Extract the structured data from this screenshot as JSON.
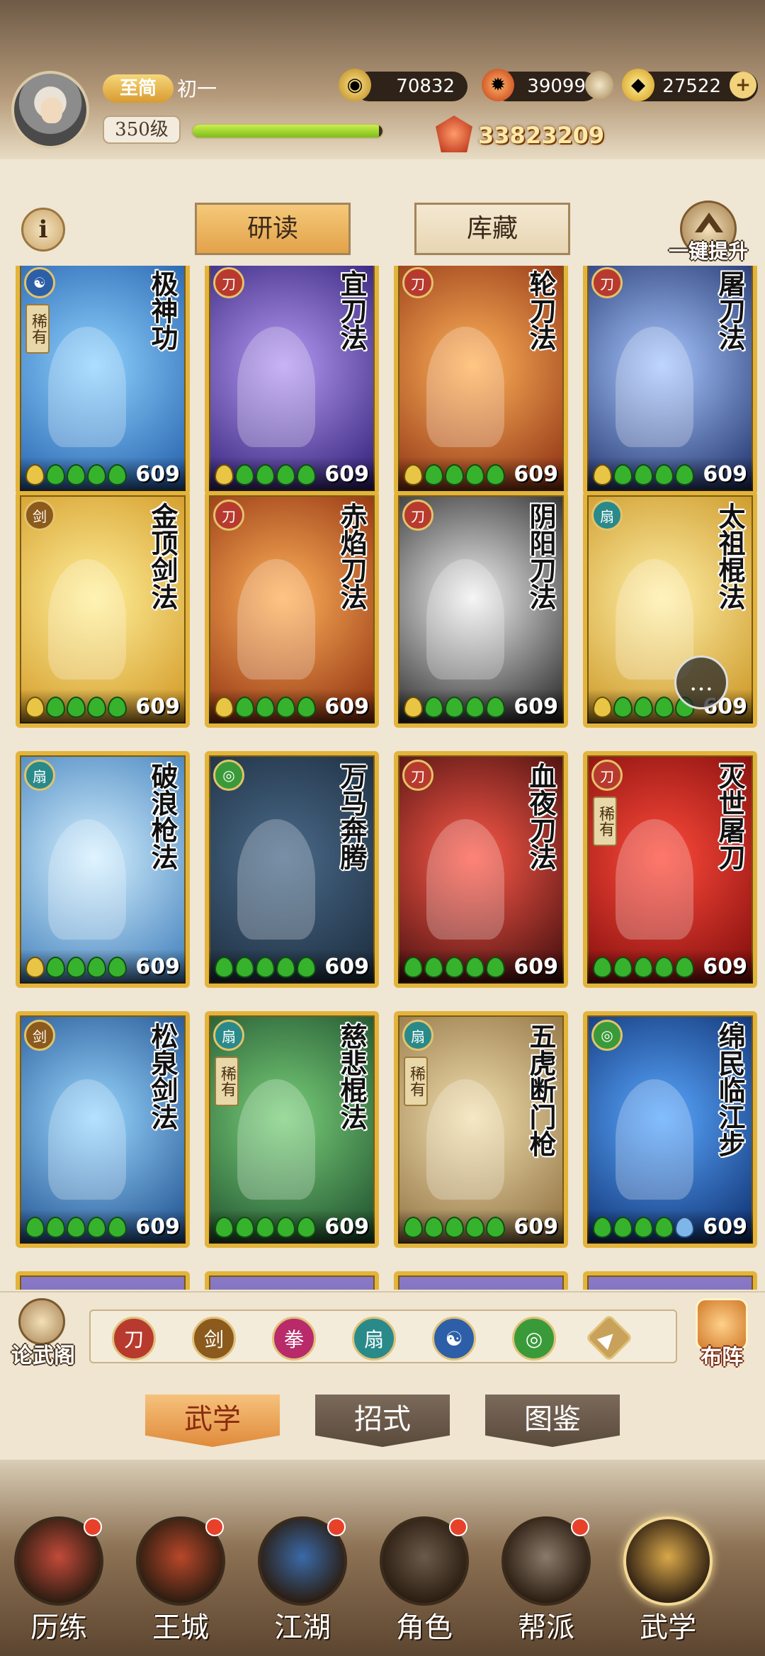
{
  "player": {
    "vip_label": "至简",
    "name": "初一",
    "level_label": "350级",
    "exp_fraction": 0.98,
    "power": "33823209"
  },
  "resources": [
    {
      "icon": "copper-coin-icon",
      "value": "70832",
      "color": "#e3b04a"
    },
    {
      "icon": "flame-essence-icon",
      "value": "39099",
      "color": "#e35b2a"
    },
    {
      "icon": "gold-ingot-icon",
      "value": "27522",
      "color": "#f0c23a",
      "has_add": true
    }
  ],
  "tabs": {
    "info_label": "i",
    "read_label": "研读",
    "store_label": "库藏",
    "upgrade_label": "一键提升"
  },
  "cards": [
    {
      "name": "极神功",
      "type_icon": "taiji-icon",
      "rare": "稀有",
      "level": "609",
      "dots": [
        "gold",
        "green",
        "green",
        "green",
        "green"
      ],
      "bg": [
        "#8fd3ff",
        "#1f5aa8"
      ],
      "type_color": "#2d5fa8"
    },
    {
      "name": "宜刀法",
      "type_icon": "sword-icon",
      "rare": "",
      "level": "609",
      "dots": [
        "gold",
        "green",
        "green",
        "green",
        "green"
      ],
      "bg": [
        "#b59af2",
        "#2b1a72"
      ],
      "type_color": "#b83a2e"
    },
    {
      "name": "轮刀法",
      "type_icon": "sword-icon",
      "rare": "",
      "level": "609",
      "dots": [
        "gold",
        "green",
        "green",
        "green",
        "green"
      ],
      "bg": [
        "#ffb35a",
        "#8a2b10"
      ],
      "type_color": "#b83a2e"
    },
    {
      "name": "屠刀法",
      "type_icon": "sword-icon",
      "rare": "",
      "level": "609",
      "dots": [
        "gold",
        "green",
        "green",
        "green",
        "green"
      ],
      "bg": [
        "#a9c8ff",
        "#1a2c66"
      ],
      "type_color": "#b83a2e"
    },
    {
      "name": "金顶剑法",
      "type_icon": "blade-icon",
      "rare": "",
      "level": "609",
      "dots": [
        "gold",
        "green",
        "green",
        "green",
        "green"
      ],
      "bg": [
        "#fff09a",
        "#d09420"
      ],
      "type_color": "#8b5a1c"
    },
    {
      "name": "赤焰刀法",
      "type_icon": "sword-icon",
      "rare": "",
      "level": "609",
      "dots": [
        "gold",
        "green",
        "green",
        "green",
        "green"
      ],
      "bg": [
        "#ffb15a",
        "#8a2a0c"
      ],
      "type_color": "#b83a2e"
    },
    {
      "name": "阴阳刀法",
      "type_icon": "sword-icon",
      "rare": "",
      "level": "609",
      "dots": [
        "gold",
        "green",
        "green",
        "green",
        "green"
      ],
      "bg": [
        "#f2f2f2",
        "#1c1c1c"
      ],
      "type_color": "#b83a2e"
    },
    {
      "name": "太祖棍法",
      "type_icon": "fan-icon",
      "rare": "",
      "level": "609",
      "dots": [
        "gold",
        "green",
        "green",
        "green",
        "green"
      ],
      "bg": [
        "#fff0a8",
        "#c8901c"
      ],
      "type_color": "#2a8a8a"
    },
    {
      "name": "破浪枪法",
      "type_icon": "fan-icon",
      "rare": "",
      "level": "609",
      "dots": [
        "gold",
        "green",
        "green",
        "green",
        "green"
      ],
      "bg": [
        "#d4f0ff",
        "#3a7ab8"
      ],
      "type_color": "#2a8a8a"
    },
    {
      "name": "万马奔腾",
      "type_icon": "swirl-icon",
      "rare": "",
      "level": "609",
      "dots": [
        "green",
        "green",
        "green",
        "green",
        "green"
      ],
      "bg": [
        "#4a6a8a",
        "#1a2a3a"
      ],
      "type_color": "#3a9a3a"
    },
    {
      "name": "血夜刀法",
      "type_icon": "sword-icon",
      "rare": "",
      "level": "609",
      "dots": [
        "green",
        "green",
        "green",
        "green",
        "green"
      ],
      "bg": [
        "#ff5a4a",
        "#3a0a0a"
      ],
      "type_color": "#b83a2e"
    },
    {
      "name": "灭世屠刀",
      "type_icon": "sword-icon",
      "rare": "稀有",
      "level": "609",
      "dots": [
        "green",
        "green",
        "green",
        "green",
        "green"
      ],
      "bg": [
        "#ff4a3a",
        "#7a0a0a"
      ],
      "type_color": "#b83a2e"
    },
    {
      "name": "松泉剑法",
      "type_icon": "blade-icon",
      "rare": "",
      "level": "609",
      "dots": [
        "green",
        "green",
        "green",
        "green",
        "green"
      ],
      "bg": [
        "#9ad8ff",
        "#1a4a8a"
      ],
      "type_color": "#8b5a1c"
    },
    {
      "name": "慈悲棍法",
      "type_icon": "fan-icon",
      "rare": "稀有",
      "level": "609",
      "dots": [
        "green",
        "green",
        "green",
        "green",
        "green"
      ],
      "bg": [
        "#7ad07a",
        "#1a4a2a"
      ],
      "type_color": "#2a8a8a"
    },
    {
      "name": "五虎断门枪",
      "type_icon": "fan-icon",
      "rare": "稀有",
      "level": "609",
      "dots": [
        "green",
        "green",
        "green",
        "green",
        "green"
      ],
      "bg": [
        "#f2e0b0",
        "#8a6a3a"
      ],
      "type_color": "#2a8a8a"
    },
    {
      "name": "绵民临江步",
      "type_icon": "swirl-icon",
      "rare": "",
      "level": "609",
      "dots": [
        "green",
        "green",
        "green",
        "green",
        "blue"
      ],
      "bg": [
        "#5aa8ff",
        "#0a2a6a"
      ],
      "type_color": "#3a9a3a"
    }
  ],
  "chat_icon": "chat-bubble-icon",
  "filter": {
    "left_label": "论武阁",
    "right_label": "布阵",
    "icons": [
      {
        "name": "sword-filter-icon",
        "glyph": "刀",
        "color": "#b83a2e"
      },
      {
        "name": "blade-filter-icon",
        "glyph": "剑",
        "color": "#8b5a1c"
      },
      {
        "name": "fist-filter-icon",
        "glyph": "拳",
        "color": "#b82a6a"
      },
      {
        "name": "fan-filter-icon",
        "glyph": "扇",
        "color": "#2a8a8a"
      },
      {
        "name": "taiji-filter-icon",
        "glyph": "☯",
        "color": "#2d5fa8"
      },
      {
        "name": "swirl-filter-icon",
        "glyph": "◎",
        "color": "#3a9a3a"
      },
      {
        "name": "rank-up-filter-icon",
        "glyph": "▲",
        "color": "#c8a25a"
      }
    ]
  },
  "subtabs": [
    {
      "label": "武学",
      "active": true
    },
    {
      "label": "招式",
      "active": false
    },
    {
      "label": "图鉴",
      "active": false
    }
  ],
  "nav": [
    {
      "label": "历练",
      "badge": true,
      "color": "#c24a3a"
    },
    {
      "label": "王城",
      "badge": true,
      "color": "#b8472a"
    },
    {
      "label": "江湖",
      "badge": true,
      "color": "#3a6aa8"
    },
    {
      "label": "角色",
      "badge": true,
      "color": "#6a5a4a"
    },
    {
      "label": "帮派",
      "badge": true,
      "color": "#8a7a6a"
    },
    {
      "label": "武学",
      "badge": false,
      "color": "#d9a84a",
      "active": true
    }
  ]
}
